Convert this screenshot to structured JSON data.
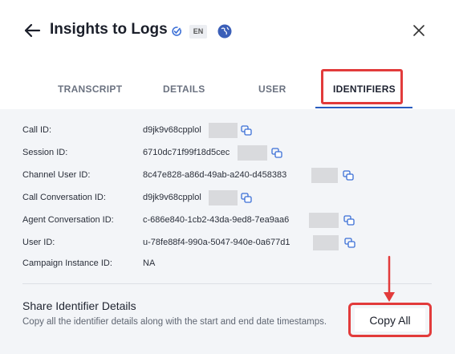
{
  "header": {
    "title": "Insights to Logs",
    "language": "EN",
    "icons": [
      "back-arrow-icon",
      "check-badge-icon",
      "globe-icon",
      "close-icon"
    ]
  },
  "tabs": [
    {
      "label": "TRANSCRIPT",
      "active": false
    },
    {
      "label": "DETAILS",
      "active": false
    },
    {
      "label": "USER",
      "active": false
    },
    {
      "label": "IDENTIFIERS",
      "active": true
    }
  ],
  "identifiers": [
    {
      "label": "Call ID:",
      "value": "d9jk9v68cpplol"
    },
    {
      "label": "Session ID:",
      "value": "6710dc71f99f18d5cec"
    },
    {
      "label": "Channel User ID:",
      "value": "8c47e828-a86d-49ab-a240-d458383"
    },
    {
      "label": "Call Conversation ID:",
      "value": "d9jk9v68cpplol"
    },
    {
      "label": "Agent Conversation ID:",
      "value": "c-686e840-1cb2-43da-9ed8-7ea9aa6"
    },
    {
      "label": "User ID:",
      "value": "u-78fe88f4-990a-5047-940e-0a677d1"
    },
    {
      "label": "Campaign Instance ID:",
      "value": "NA"
    }
  ],
  "share": {
    "title": "Share Identifier Details",
    "description": "Copy all the identifier details along with the start and end date timestamps.",
    "button_label": "Copy All"
  },
  "colors": {
    "accent_blue": "#2a5dbf",
    "highlight_red": "#e23b3b"
  }
}
